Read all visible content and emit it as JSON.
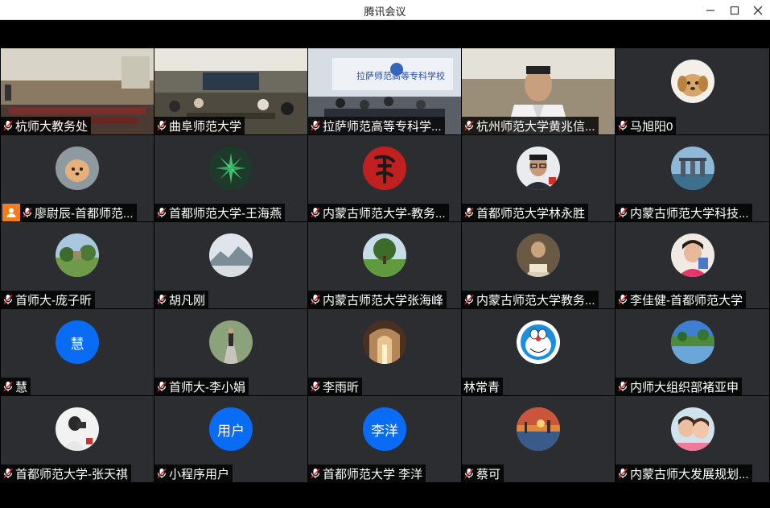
{
  "window": {
    "title": "腾讯会议",
    "minimize_icon": "minimize-icon",
    "maximize_icon": "maximize-icon",
    "close_icon": "close-icon"
  },
  "participants": [
    {
      "name": "杭师大教务处",
      "kind": "video",
      "muted": true
    },
    {
      "name": "曲阜师范大学",
      "kind": "video",
      "muted": true
    },
    {
      "name": "拉萨师范高等专科学...",
      "kind": "video",
      "muted": true
    },
    {
      "name": "杭州师范大学黄兆信...",
      "kind": "video",
      "muted": true
    },
    {
      "name": "马旭阳0",
      "kind": "avatar",
      "avatar": "dog-photo",
      "muted": true
    },
    {
      "name": "廖尉辰-首都师范...",
      "kind": "avatar",
      "avatar": "fluffy-dog-photo",
      "muted": true,
      "badge": "user-icon"
    },
    {
      "name": "首都师范大学-王海燕",
      "kind": "avatar",
      "avatar": "green-plant-photo",
      "muted": true
    },
    {
      "name": "内蒙古师范大学-教务...",
      "kind": "avatar",
      "avatar": "red-calligraphy-logo",
      "muted": true
    },
    {
      "name": "首都师范大学林永胜",
      "kind": "avatar",
      "avatar": "man-glasses-photo",
      "muted": true
    },
    {
      "name": "内蒙古师范大学科技...",
      "kind": "avatar",
      "avatar": "city-skyline-photo",
      "muted": true
    },
    {
      "name": "首师大-庞子昕",
      "kind": "avatar",
      "avatar": "garden-photo",
      "muted": true
    },
    {
      "name": "胡凡刚",
      "kind": "avatar",
      "avatar": "misty-mountain-photo",
      "muted": true
    },
    {
      "name": "内蒙古师范大学张海峰",
      "kind": "avatar",
      "avatar": "park-trees-photo",
      "muted": true
    },
    {
      "name": "内蒙古师范大学教务...",
      "kind": "avatar",
      "avatar": "person-reading-photo",
      "muted": true
    },
    {
      "name": "李佳健-首都师范大学",
      "kind": "avatar",
      "avatar": "child-photo",
      "muted": true
    },
    {
      "name": "慧",
      "kind": "avatar",
      "avatar_text": "慧",
      "muted": true
    },
    {
      "name": "首师大-李小娟",
      "kind": "avatar",
      "avatar": "person-road-photo",
      "muted": true
    },
    {
      "name": "李雨昕",
      "kind": "avatar",
      "avatar": "cathedral-photo",
      "muted": true
    },
    {
      "name": "林常青",
      "kind": "avatar",
      "avatar": "doraemon-avatar",
      "muted": false
    },
    {
      "name": "内师大组织部褚亚申",
      "kind": "avatar",
      "avatar": "lake-landscape-photo",
      "muted": true
    },
    {
      "name": "首都师范大学-张天祺",
      "kind": "avatar",
      "avatar": "photographer-photo",
      "muted": true
    },
    {
      "name": "小程序用户",
      "kind": "avatar",
      "avatar_text": "用户",
      "muted": true
    },
    {
      "name": "首都师范大学 李洋",
      "kind": "avatar",
      "avatar_text": "李洋",
      "muted": true
    },
    {
      "name": "蔡可",
      "kind": "avatar",
      "avatar": "sunset-painting",
      "muted": true
    },
    {
      "name": "内蒙古师大发展规划...",
      "kind": "avatar",
      "avatar": "two-children-photo",
      "muted": true
    }
  ],
  "colors": {
    "tile_bg": "#2b2d30",
    "text_avatar_bg": "#0a6cf5",
    "muted_mic": "#e02a2a",
    "badge_orange": "#f07e1c"
  }
}
